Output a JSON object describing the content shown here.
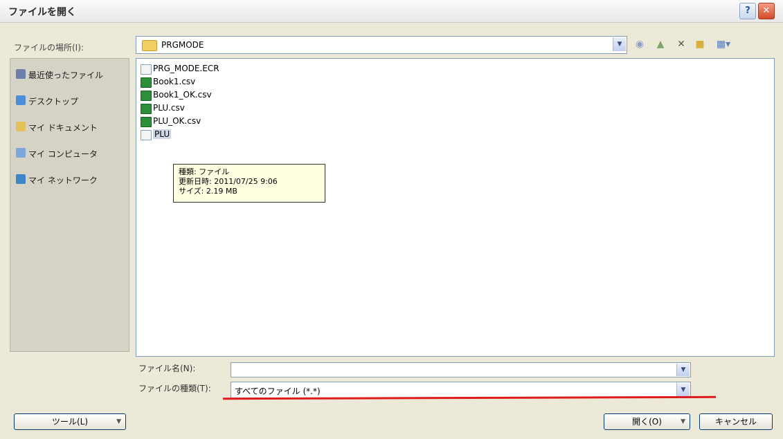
{
  "window": {
    "title": "ファイルを開く",
    "help_label": "?",
    "close_label": "✕"
  },
  "lookin": {
    "label": "ファイルの場所(I):",
    "value": "PRGMODE"
  },
  "toolbar": {
    "back_icon": "back-icon",
    "up_icon": "up-folder-icon",
    "delete_icon": "delete-icon",
    "new_folder_icon": "new-folder-icon",
    "views_icon": "views-menu-icon"
  },
  "places": [
    {
      "label": "最近使ったファイル",
      "icon": "recent-icon",
      "color": "#6b7fa8"
    },
    {
      "label": "デスクトップ",
      "icon": "desktop-icon",
      "color": "#4a8fd8"
    },
    {
      "label": "マイ ドキュメント",
      "icon": "documents-icon",
      "color": "#e3c15a"
    },
    {
      "label": "マイ コンピュータ",
      "icon": "computer-icon",
      "color": "#7da7d8"
    },
    {
      "label": "マイ ネットワーク",
      "icon": "network-icon",
      "color": "#3f86c9"
    }
  ],
  "files": [
    {
      "name": "PRG_MODE.ECR",
      "type": "ecr"
    },
    {
      "name": "Book1.csv",
      "type": "csv"
    },
    {
      "name": "Book1_OK.csv",
      "type": "csv"
    },
    {
      "name": "PLU.csv",
      "type": "csv"
    },
    {
      "name": "PLU_OK.csv",
      "type": "csv"
    },
    {
      "name": "PLU",
      "type": "ecr",
      "selected": true
    }
  ],
  "tooltip": {
    "line1": "種類: ファイル",
    "line2": "更新日時: 2011/07/25 9:06",
    "line3": "サイズ: 2.19 MB"
  },
  "filename": {
    "label": "ファイル名(N):",
    "value": ""
  },
  "filetype": {
    "label": "ファイルの種類(T):",
    "value": "すべてのファイル (*.*)"
  },
  "buttons": {
    "tools": "ツール(L)",
    "open": "開く(O)",
    "cancel": "キャンセル"
  },
  "colors": {
    "dialog_bg": "#ece9d8",
    "accent_red": "#e01b1b",
    "tooltip_bg": "#ffffe1"
  }
}
